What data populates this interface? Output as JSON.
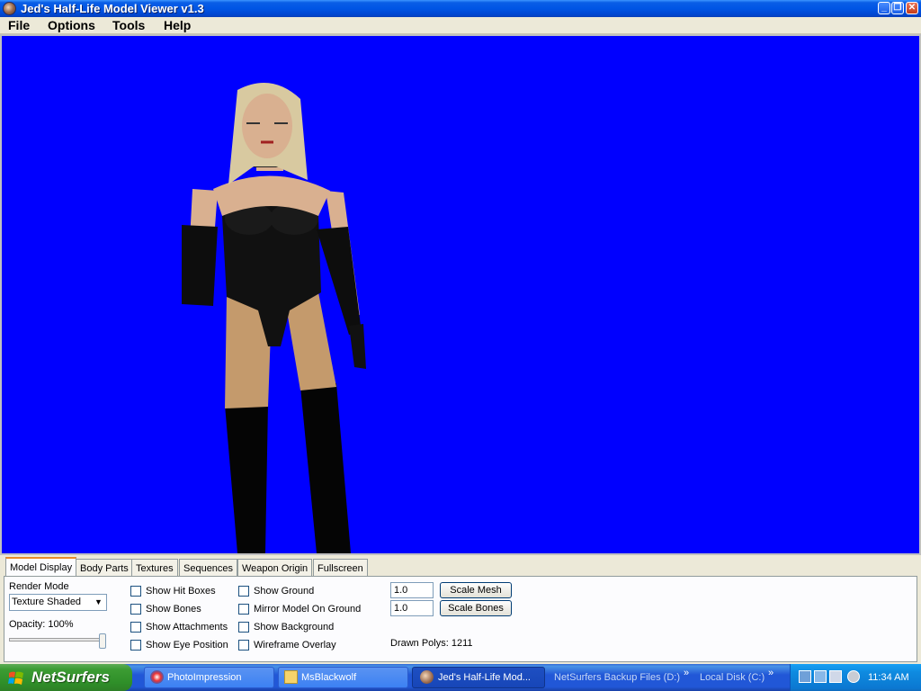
{
  "window": {
    "title": "Jed's Half-Life Model Viewer v1.3",
    "controls": [
      "minimize",
      "maximize",
      "close"
    ]
  },
  "menu": [
    "File",
    "Options",
    "Tools",
    "Help"
  ],
  "viewport": {
    "background_color": "#0000ff"
  },
  "tabs": [
    "Model Display",
    "Body Parts",
    "Textures",
    "Sequences",
    "Weapon Origin",
    "Fullscreen"
  ],
  "model_display": {
    "render_mode_label": "Render Mode",
    "render_mode_value": "Texture Shaded",
    "opacity_label": "Opacity: 100%",
    "opacity_value": 1.0,
    "checkboxes_col1": [
      "Show Hit Boxes",
      "Show Bones",
      "Show Attachments",
      "Show Eye Position"
    ],
    "checkboxes_col2": [
      "Show Ground",
      "Mirror Model On Ground",
      "Show Background",
      "Wireframe Overlay"
    ],
    "scale_mesh_value": "1.0",
    "scale_mesh_button": "Scale Mesh",
    "scale_bones_value": "1.0",
    "scale_bones_button": "Scale Bones",
    "drawn_polys": "Drawn Polys: 1211"
  },
  "taskbar": {
    "start_label": "NetSurfers",
    "buttons": [
      "PhotoImpression",
      "MsBlackwolf",
      "Jed's Half-Life Mod..."
    ],
    "toolbars": [
      "NetSurfers Backup Files (D:)",
      "Local Disk (C:)"
    ],
    "chevron": "»",
    "clock": "11:34 AM"
  }
}
